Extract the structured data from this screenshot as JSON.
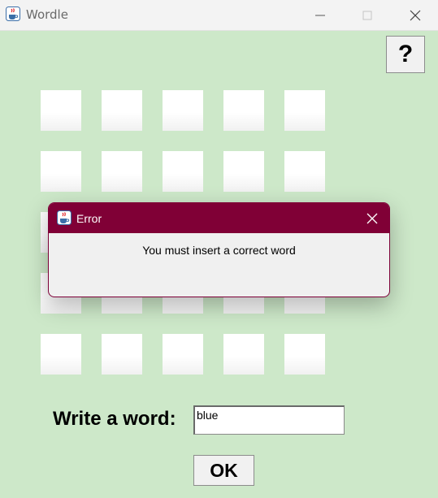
{
  "window": {
    "title": "Wordle",
    "app_icon": "java-cup-icon",
    "controls": [
      "minimize-icon",
      "maximize-icon",
      "close-icon"
    ],
    "background_color": "#cde8c9"
  },
  "help_button": {
    "label": "?"
  },
  "grid": {
    "rows": 5,
    "columns": 5,
    "tiles": [
      [
        "",
        "",
        "",
        "",
        ""
      ],
      [
        "",
        "",
        "",
        "",
        ""
      ],
      [
        "",
        "",
        "",
        "",
        ""
      ],
      [
        "",
        "",
        "",
        "",
        ""
      ],
      [
        "",
        "",
        "",
        "",
        ""
      ]
    ]
  },
  "word_form": {
    "label": "Write a word:",
    "input_value": "blue",
    "submit_label": "OK"
  },
  "error_dialog": {
    "title": "Error",
    "icon": "java-cup-icon",
    "message": "You must insert a correct word",
    "accent_color": "#800036"
  }
}
